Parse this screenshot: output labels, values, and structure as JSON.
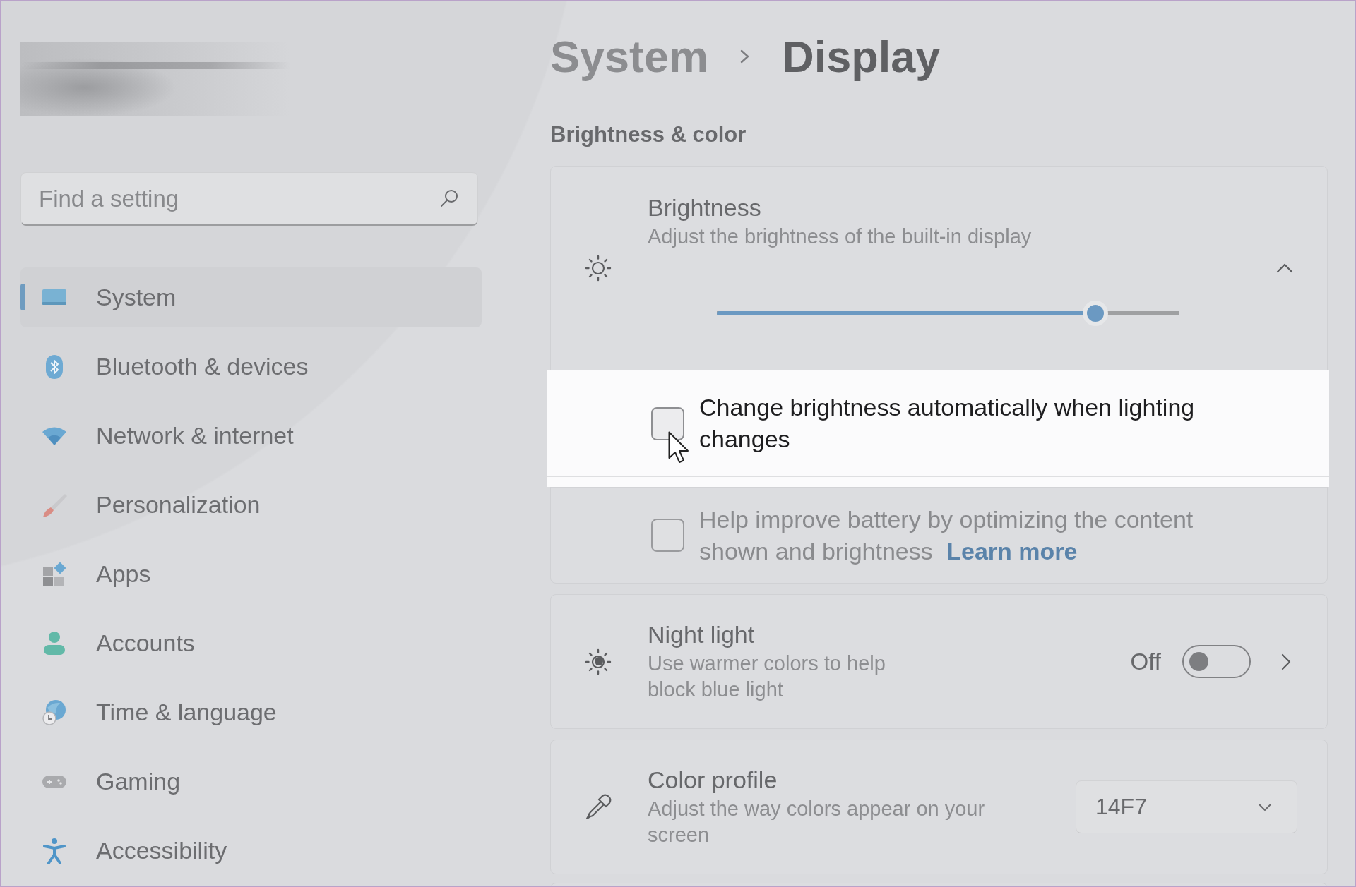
{
  "sidebar": {
    "search": {
      "placeholder": "Find a setting"
    },
    "items": [
      {
        "label": "System",
        "selected": true
      },
      {
        "label": "Bluetooth & devices",
        "selected": false
      },
      {
        "label": "Network & internet",
        "selected": false
      },
      {
        "label": "Personalization",
        "selected": false
      },
      {
        "label": "Apps",
        "selected": false
      },
      {
        "label": "Accounts",
        "selected": false
      },
      {
        "label": "Time & language",
        "selected": false
      },
      {
        "label": "Gaming",
        "selected": false
      },
      {
        "label": "Accessibility",
        "selected": false
      }
    ]
  },
  "breadcrumb": [
    {
      "label": "System",
      "current": false
    },
    {
      "label": "Display",
      "current": true
    }
  ],
  "section_title": "Brightness & color",
  "cards": [
    {
      "kind": "expander",
      "title": "Brightness",
      "subtitle": "Adjust the brightness of the built-in display",
      "expanded": true,
      "slider": {
        "level": 0.82
      },
      "options": [
        {
          "label": "Change brightness automatically when lighting changes",
          "checked": false,
          "highlighted": true
        },
        {
          "label": "Help improve battery by optimizing the content shown and brightness",
          "link": "Learn more",
          "checked": false,
          "highlighted": false
        }
      ]
    },
    {
      "kind": "toggle",
      "title": "Night light",
      "subtitle": "Use warmer colors to help block blue light",
      "state_label": "Off",
      "on": false
    },
    {
      "kind": "dropdown",
      "title": "Color profile",
      "subtitle": "Adjust the way colors appear on your screen",
      "value": "14F7"
    }
  ]
}
